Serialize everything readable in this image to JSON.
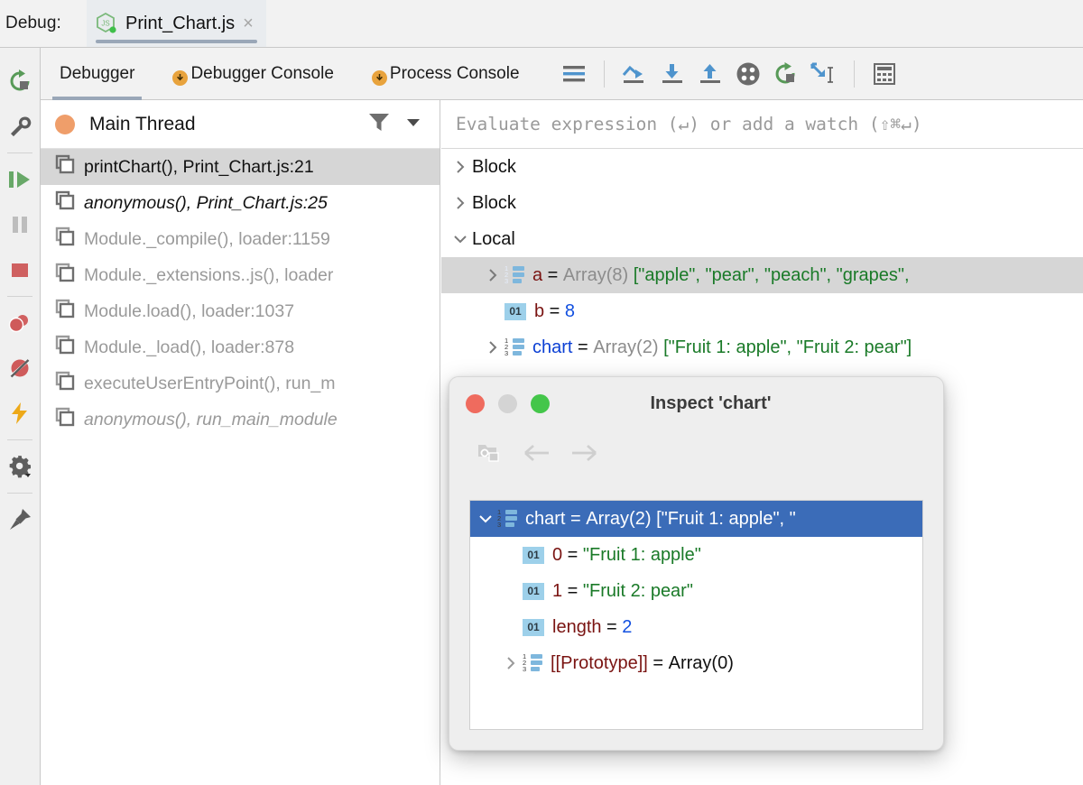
{
  "window": {
    "label": "Debug:",
    "tab": {
      "filename": "Print_Chart.js",
      "close": "×",
      "icon": "nodejs-icon"
    }
  },
  "vertical_toolbar": [
    {
      "name": "rerun-button",
      "icon": "rerun-icon",
      "tooltip": "Rerun"
    },
    {
      "name": "edit-configuration-button",
      "icon": "wrench-icon",
      "tooltip": "Edit Configuration"
    },
    {
      "name": "resume-button",
      "icon": "resume-icon",
      "tooltip": "Resume Program"
    },
    {
      "name": "pause-button",
      "icon": "pause-icon",
      "tooltip": "Pause Program"
    },
    {
      "name": "stop-button",
      "icon": "stop-icon",
      "tooltip": "Stop"
    },
    {
      "name": "view-breakpoints-button",
      "icon": "breakpoints-icon",
      "tooltip": "View Breakpoints"
    },
    {
      "name": "mute-breakpoints-button",
      "icon": "mute-breakpoints-icon",
      "tooltip": "Mute Breakpoints"
    },
    {
      "name": "settings-lightning-button",
      "icon": "lightning-icon",
      "tooltip": "Restore Layout"
    },
    {
      "name": "settings-button",
      "icon": "gear-icon",
      "tooltip": "Settings"
    },
    {
      "name": "pin-button",
      "icon": "pin-icon",
      "tooltip": "Pin Tab"
    }
  ],
  "tabs": [
    {
      "label": "Debugger",
      "active": true,
      "badge": false
    },
    {
      "label": "Debugger Console",
      "active": false,
      "badge": true
    },
    {
      "label": "Process Console",
      "active": false,
      "badge": true
    }
  ],
  "debug_toolbar": [
    {
      "name": "show-execution-point-button",
      "icon": "lines-icon"
    },
    {
      "name": "step-over-button",
      "icon": "step-over-icon"
    },
    {
      "name": "step-into-button",
      "icon": "step-into-icon"
    },
    {
      "name": "step-out-button",
      "icon": "step-out-icon"
    },
    {
      "name": "force-step-into-button",
      "icon": "force-step-into-icon"
    },
    {
      "name": "drop-frame-button",
      "icon": "drop-frame-icon"
    },
    {
      "name": "run-to-cursor-button",
      "icon": "run-to-cursor-icon"
    },
    {
      "name": "evaluate-expression-button",
      "icon": "calculator-icon"
    }
  ],
  "frames": {
    "thread": {
      "name": "Main Thread",
      "status_color": "#ef9e6a"
    },
    "filter_icon": "filter-icon",
    "dropdown_icon": "chevron-down-icon",
    "items": [
      {
        "text": "printChart(), Print_Chart.js:21",
        "selected": true,
        "muted": false,
        "italic": false
      },
      {
        "text": "anonymous(), Print_Chart.js:25",
        "selected": false,
        "muted": false,
        "italic": true
      },
      {
        "text": "Module._compile(), loader:1159",
        "selected": false,
        "muted": true,
        "italic": false
      },
      {
        "text": "Module._extensions..js(), loader",
        "selected": false,
        "muted": true,
        "italic": false
      },
      {
        "text": "Module.load(), loader:1037",
        "selected": false,
        "muted": true,
        "italic": false
      },
      {
        "text": "Module._load(), loader:878",
        "selected": false,
        "muted": true,
        "italic": false
      },
      {
        "text": "executeUserEntryPoint(), run_m",
        "selected": false,
        "muted": true,
        "italic": false
      },
      {
        "text": "anonymous(), run_main_module",
        "selected": false,
        "muted": true,
        "italic": true
      }
    ]
  },
  "variables": {
    "evaluate_placeholder": "Evaluate expression (↵) or add a watch (⇧⌘↵)",
    "groups": [
      {
        "label": "Block",
        "expanded": false
      },
      {
        "label": "Block",
        "expanded": false
      },
      {
        "label": "Local",
        "expanded": true
      }
    ],
    "locals": [
      {
        "icon": "array-icon",
        "expandable": true,
        "selected": true,
        "name": "a",
        "name_color": "red",
        "type": "Array(8)",
        "value": "[\"apple\", \"pear\", \"peach\", \"grapes\","
      },
      {
        "icon": "primitive-icon",
        "expandable": false,
        "selected": false,
        "name": "b",
        "name_color": "red",
        "type": "",
        "value": "8",
        "value_kind": "number"
      },
      {
        "icon": "array-icon",
        "expandable": true,
        "selected": false,
        "name": "chart",
        "name_color": "blue",
        "type": "Array(2)",
        "value": "[\"Fruit 1: apple\", \"Fruit 2: pear\"]"
      }
    ]
  },
  "dialog": {
    "title": "Inspect 'chart'",
    "traffic_lights": [
      "close-button",
      "minimize-button",
      "zoom-button"
    ],
    "toolbar": [
      {
        "name": "inspect-icon",
        "enabled": false
      },
      {
        "name": "back-arrow-icon",
        "enabled": false
      },
      {
        "name": "forward-arrow-icon",
        "enabled": false
      }
    ],
    "rows": [
      {
        "icon": "array-icon",
        "expandable": true,
        "expanded": true,
        "selected": true,
        "name": "chart",
        "type": "Array(2)",
        "value": "[\"Fruit 1: apple\", \"",
        "indent": 1
      },
      {
        "icon": "primitive-icon",
        "expandable": false,
        "selected": false,
        "name": "0",
        "value": "\"Fruit 1: apple\"",
        "value_kind": "string",
        "indent": 2
      },
      {
        "icon": "primitive-icon",
        "expandable": false,
        "selected": false,
        "name": "1",
        "value": "\"Fruit 2: pear\"",
        "value_kind": "string",
        "indent": 2
      },
      {
        "icon": "primitive-icon",
        "expandable": false,
        "selected": false,
        "name": "length",
        "value": "2",
        "value_kind": "number",
        "indent": 2
      },
      {
        "icon": "array-icon",
        "expandable": true,
        "expanded": false,
        "selected": false,
        "name": "[[Prototype]]",
        "value": "Array(0)",
        "value_kind": "plain",
        "indent": 3
      }
    ]
  },
  "colors": {
    "accent_blue": "#3b6cb8",
    "string_green": "#1a7a28",
    "number_blue": "#1250e0",
    "name_red": "#7a1412",
    "name_blue": "#0b3fd4",
    "selection_gray": "#d6d6d6",
    "thread_orange": "#ef9e6a",
    "badge_orange": "#e8a33d"
  }
}
